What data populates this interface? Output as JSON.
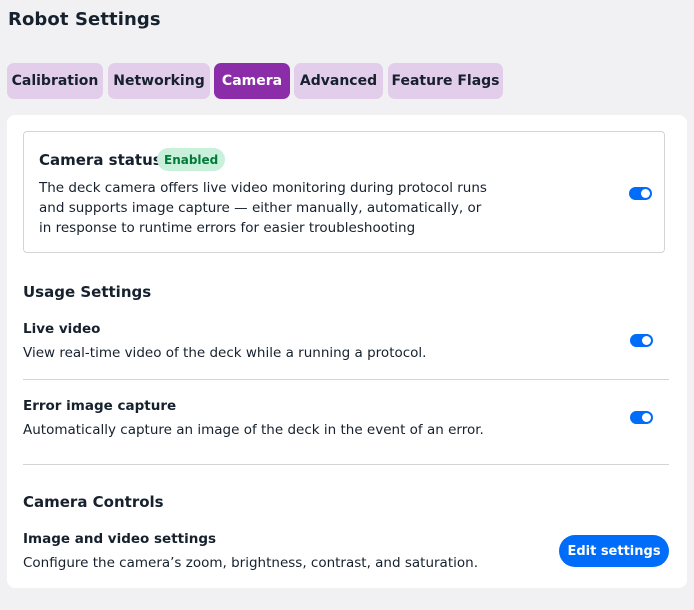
{
  "page": {
    "title": "Robot Settings"
  },
  "tabs": [
    {
      "label": "Calibration",
      "active": false
    },
    {
      "label": "Networking",
      "active": false
    },
    {
      "label": "Camera",
      "active": true
    },
    {
      "label": "Advanced",
      "active": false
    },
    {
      "label": "Feature Flags",
      "active": false
    }
  ],
  "camera_status": {
    "title": "Camera status",
    "badge": "Enabled",
    "description": "The deck camera offers live video monitoring during protocol runs and supports image capture — either manually, automatically, or in response to runtime errors for easier troubleshooting",
    "enabled": true
  },
  "usage_settings": {
    "heading": "Usage Settings",
    "items": [
      {
        "label": "Live video",
        "description": "View real-time video of the deck while a running a protocol.",
        "enabled": true
      },
      {
        "label": "Error image capture",
        "description": "Automatically capture an image of the deck in the event of an error.",
        "enabled": true
      }
    ]
  },
  "camera_controls": {
    "heading": "Camera Controls",
    "label": "Image and video settings",
    "description": "Configure the camera’s zoom, brightness, contrast, and saturation.",
    "button_label": "Edit settings"
  },
  "colors": {
    "tab_background": "#e2cdea",
    "tab_active": "#8b2da8",
    "toggle_on": "#006cfa",
    "button": "#006cfa",
    "badge_background": "#c8f0da",
    "badge_text": "#047a3a"
  }
}
